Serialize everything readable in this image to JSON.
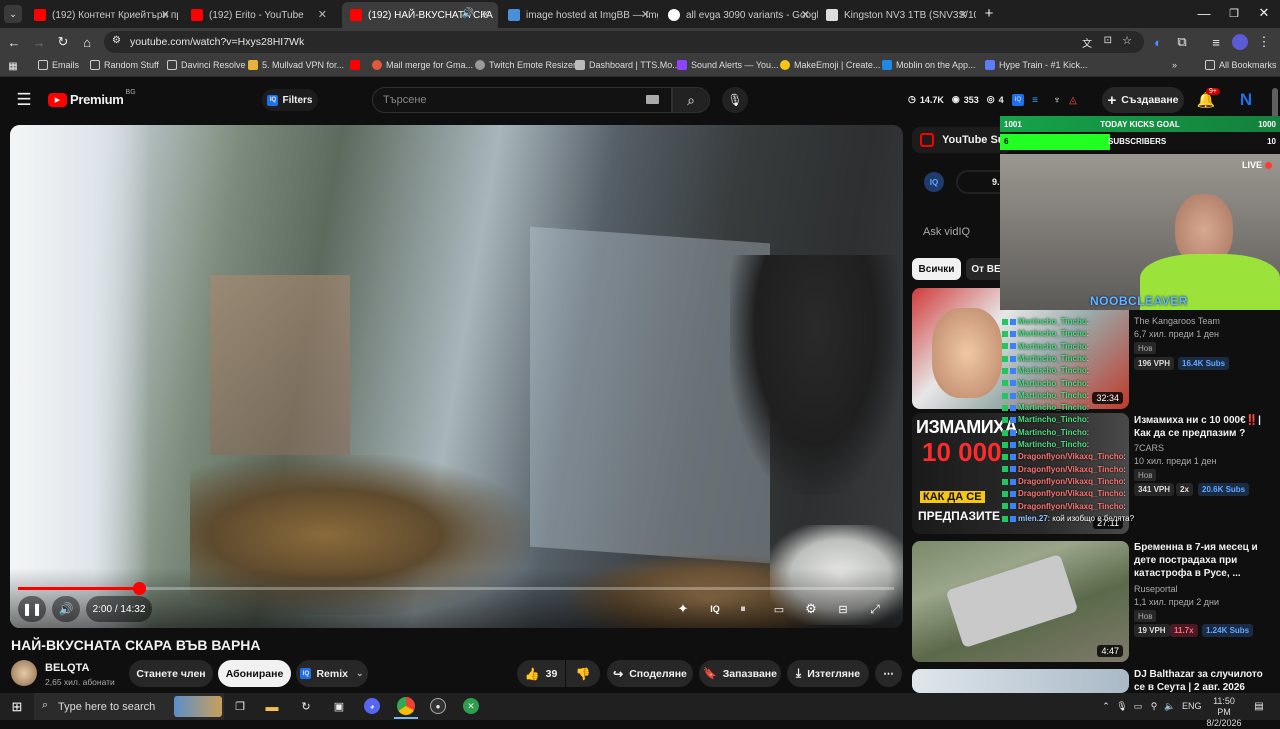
{
  "browser": {
    "tabs": [
      {
        "title": "(192) Контент Криейтъри прав",
        "icon": "youtube-favicon",
        "active": false
      },
      {
        "title": "(192) Erito - YouTube",
        "icon": "youtube-favicon",
        "active": false
      },
      {
        "title": "(192) НАЙ-ВКУСНАТА СКА",
        "icon": "youtube-favicon",
        "active": true
      },
      {
        "title": "image hosted at ImgBB — Img",
        "icon": "imgbb-favicon",
        "active": false
      },
      {
        "title": "all evga 3090 variants - Google",
        "icon": "google-favicon",
        "active": false
      },
      {
        "title": "Kingston NV3 1TB (SNV3S/100",
        "icon": "site-favicon",
        "active": false
      }
    ],
    "url": "youtube.com/watch?v=Hxys28HI7Wk",
    "bookmarks": [
      {
        "label": "Emails",
        "icon": "folder-icon"
      },
      {
        "label": "Random Stuff",
        "icon": "folder-icon"
      },
      {
        "label": "Davinci Resolve",
        "icon": "folder-icon"
      },
      {
        "label": "5. Mullvad VPN for...",
        "icon": "mullvad-icon"
      },
      {
        "label": "",
        "icon": "youtube-icon"
      },
      {
        "label": "Mail merge for Gma...",
        "icon": "mail-merge-icon"
      },
      {
        "label": "Twitch Emote Resizer",
        "icon": "resizer-icon"
      },
      {
        "label": "Dashboard | TTS.Mo...",
        "icon": "tts-icon"
      },
      {
        "label": "Sound Alerts — You...",
        "icon": "soundalerts-icon"
      },
      {
        "label": "MakeEmoji | Create...",
        "icon": "emoji-icon"
      },
      {
        "label": "Moblin on the App...",
        "icon": "appstore-icon"
      },
      {
        "label": "Hype Train - #1 Kick...",
        "icon": "hypetrain-icon"
      }
    ],
    "all_bookmarks": "All Bookmarks"
  },
  "yt_header": {
    "logo": "Premium",
    "logo_region": "BG",
    "filters": "Filters",
    "search_placeholder": "Търсене",
    "stats": {
      "views": "14.7K",
      "subs": "353",
      "eye": "4"
    },
    "create": "Създаване",
    "notif_count": "9+"
  },
  "player": {
    "time": "2:00 / 14:32",
    "progress_fraction": 0.1376
  },
  "video_info": {
    "title": "НАЙ-ВКУСНАТА СКАРА ВЪВ ВАРНА",
    "channel": "BELQTA",
    "subscribers": "2,65 хил. абонати",
    "join": "Станете член",
    "subscribe": "Абониране",
    "remix": "Remix",
    "likes": "39",
    "share": "Споделяне",
    "save": "Запазване",
    "download": "Изтегляне"
  },
  "sidebar": {
    "summary_label": "YouTube Sum",
    "vidiq_score": "9.0",
    "ask": "Ask vidIQ",
    "chips": [
      "Всички",
      "От BE"
    ],
    "videos": [
      {
        "title": "",
        "channel": "The Kangaroos Team",
        "meta": "6,7 хил.  преди 1 ден",
        "badge": "Нов",
        "vph": "196 VPH",
        "subs": "16.4K Subs",
        "duration": "32:34"
      },
      {
        "title": "Измамиха ни с 10 000€‼️| Как да се предпазим ?",
        "channel": "7CARS",
        "meta": "10 хил.  преди 1 ден",
        "badge": "Нов",
        "vph": "341 VPH",
        "mult": "2x",
        "subs": "20.6K Subs",
        "duration": "27:11",
        "thumb_text_1": "ИЗМАМИХА",
        "thumb_text_2": "10 000",
        "thumb_text_3": "КАК ДА СЕ",
        "thumb_text_4": "ПРЕДПАЗИТЕ"
      },
      {
        "title": "Бременна в 7-ия месец и дете пострадаха при катастрофа в Русе, ...",
        "channel": "Ruseportal",
        "meta": "1,1 хил.  преди 2 дни",
        "badge": "Нов",
        "vph": "19 VPH",
        "mult": "11.7x",
        "subs": "1.24K Subs",
        "duration": "4:47"
      },
      {
        "title": "DJ Balthazar за случилото се в Сеута | 2 авг. 2026",
        "channel": "",
        "meta": "",
        "badge": "",
        "vph": "",
        "subs": "",
        "duration": ""
      }
    ]
  },
  "stream_overlay": {
    "goal_left": "1001",
    "goal_title": "TODAY KICKS GOAL",
    "goal_right": "1000",
    "subs_left": "6",
    "subs_title": "SUBSCRIBERS",
    "subs_right": "10",
    "live": "LIVE",
    "streamer": "NOOBCLEAVER",
    "chat": [
      {
        "user": "Martincho_Tincho",
        "msg": ":"
      },
      {
        "user": "Martincho_Tincho",
        "msg": ":"
      },
      {
        "user": "Martincho_Tincho",
        "msg": ":"
      },
      {
        "user": "Martincho_Tincho",
        "msg": ":"
      },
      {
        "user": "Martincho_Tincho",
        "msg": ":"
      },
      {
        "user": "Martincho_Tincho",
        "msg": ":"
      },
      {
        "user": "Martincho_Tincho",
        "msg": ":"
      },
      {
        "user": "Martincho_Tincho",
        "msg": ":"
      },
      {
        "user": "Martincho_Tincho",
        "msg": ":"
      },
      {
        "user": "Martincho_Tincho",
        "msg": ":"
      },
      {
        "user": "Martincho_Tincho",
        "msg": ":"
      },
      {
        "user": "Dragonflyon/Vikaxq_Tincho",
        "msg": ":"
      },
      {
        "user": "Dragonflyon/Vikaxq_Tincho",
        "msg": ":"
      },
      {
        "user": "Dragonflyon/Vikaxq_Tincho",
        "msg": ":"
      },
      {
        "user": "Dragonflyon/Vikaxq_Tincho",
        "msg": ":"
      },
      {
        "user": "Dragonflyon/Vikaxq_Tincho",
        "msg": ":"
      },
      {
        "user": "mlen.27",
        "msg": ": кой изобщо е белята?"
      }
    ]
  },
  "taskbar": {
    "search": "Type here to search",
    "lang": "ENG",
    "time": "11:50 PM",
    "date": "8/2/2026"
  },
  "colors": {
    "yt_red": "#ff0000",
    "accent_blue": "#3ea6ff",
    "vidiq_blue": "#1f6feb"
  }
}
